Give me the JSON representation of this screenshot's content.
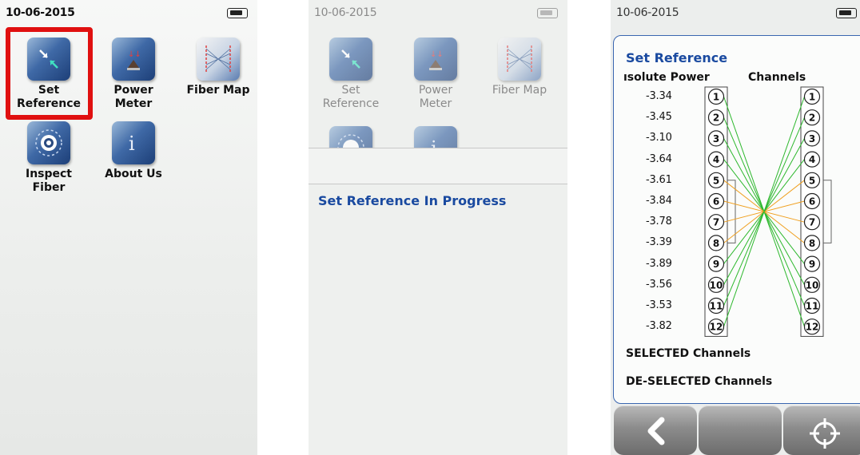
{
  "panel1": {
    "date": "10-06-2015",
    "apps": [
      {
        "label": "Set Reference",
        "lines": [
          "Set",
          "Reference"
        ],
        "icon": "set-reference-icon",
        "selected": true
      },
      {
        "label": "Power Meter",
        "lines": [
          "Power",
          "Meter"
        ],
        "icon": "power-meter-icon"
      },
      {
        "label": "Fiber Map",
        "lines": [
          "Fiber Map"
        ],
        "icon": "fiber-map-icon"
      },
      {
        "label": "Inspect Fiber",
        "lines": [
          "Inspect",
          "Fiber"
        ],
        "icon": "inspect-fiber-icon"
      },
      {
        "label": "About Us",
        "lines": [
          "About Us"
        ],
        "icon": "info-icon"
      }
    ]
  },
  "panel2": {
    "date": "10-06-2015",
    "apps": [
      {
        "lines": [
          "Set",
          "Reference"
        ],
        "icon": "set-reference-icon"
      },
      {
        "lines": [
          "Power",
          "Meter"
        ],
        "icon": "power-meter-icon"
      },
      {
        "lines": [
          "Fiber Map"
        ],
        "icon": "fiber-map-icon"
      }
    ],
    "status": "Set Reference In Progress"
  },
  "panel3": {
    "date": "10-06-2015",
    "title": "Set Reference",
    "col_power": "ısolute Power",
    "col_channels": "Channels",
    "powers": [
      "-3.34",
      "-3.45",
      "-3.10",
      "-3.64",
      "-3.61",
      "-3.84",
      "-3.78",
      "-3.39",
      "-3.89",
      "-3.56",
      "-3.53",
      "-3.82"
    ],
    "channels": [
      "1",
      "2",
      "3",
      "4",
      "5",
      "6",
      "7",
      "8",
      "9",
      "10",
      "11",
      "12"
    ],
    "selected_label": "SELECTED Channels",
    "deselected_label": "DE-SELECTED Channels",
    "colors": {
      "selected": "#2db82d",
      "deselected": "#f0a020",
      "accent": "#1a4aa0"
    },
    "buttons": [
      {
        "name": "back-button",
        "icon": "chevron-left-icon"
      },
      {
        "name": "blank-button",
        "icon": ""
      },
      {
        "name": "target-button",
        "icon": "crosshair-icon"
      }
    ]
  }
}
